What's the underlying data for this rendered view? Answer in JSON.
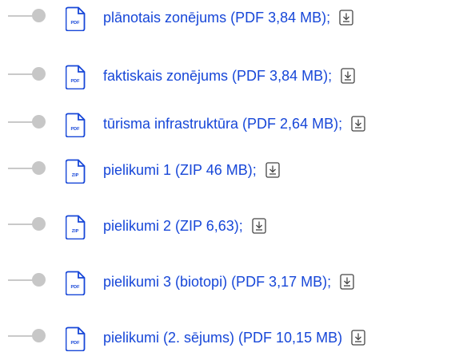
{
  "files": [
    {
      "type_label": "PDF",
      "name": "plānotais zonējums  (PDF 3,84 MB);"
    },
    {
      "type_label": "PDF",
      "name": "faktiskais zonējums (PDF 3,84 MB);"
    },
    {
      "type_label": "PDF",
      "name": "tūrisma infrastruktūra (PDF 2,64 MB);"
    },
    {
      "type_label": "ZIP",
      "name": "pielikumi 1 (ZIP 46 MB);"
    },
    {
      "type_label": "ZIP",
      "name": "pielikumi 2 (ZIP 6,63);"
    },
    {
      "type_label": "PDF",
      "name": "pielikumi 3 (biotopi) (PDF 3,17 MB);"
    },
    {
      "type_label": "PDF",
      "name": "pielikumi (2. sējums) (PDF 10,15 MB)"
    }
  ],
  "icons": {
    "file": "file-icon",
    "download": "download-icon"
  },
  "colors": {
    "link": "#1747d8",
    "bullet": "#c7c7c7"
  }
}
